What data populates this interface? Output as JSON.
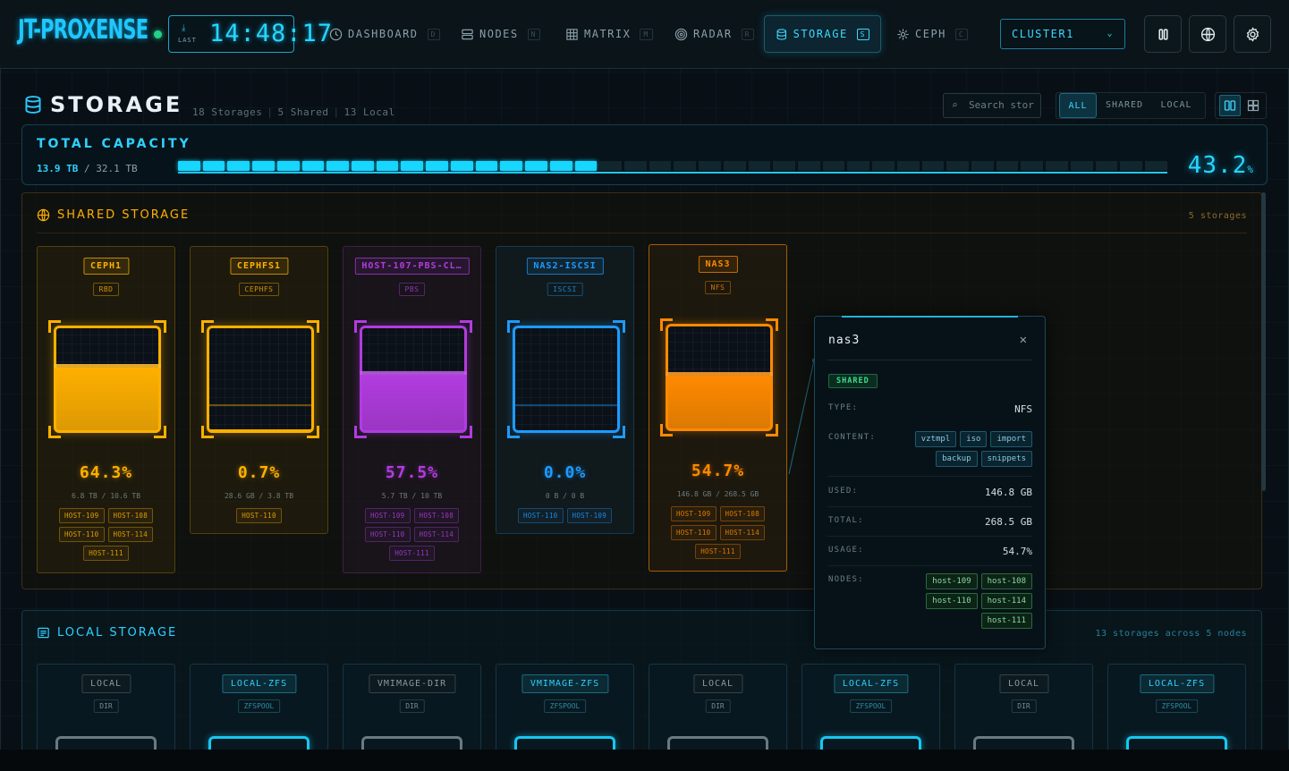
{
  "app": {
    "logo": "JT-PROXENSE",
    "clock_label": "LAST",
    "clock_time": "14:48:17"
  },
  "nav": [
    {
      "label": "DASHBOARD",
      "key": "D",
      "icon": "clock-icon"
    },
    {
      "label": "NODES",
      "key": "N",
      "icon": "server-icon"
    },
    {
      "label": "MATRIX",
      "key": "M",
      "icon": "grid-icon"
    },
    {
      "label": "RADAR",
      "key": "R",
      "icon": "radar-icon"
    },
    {
      "label": "STORAGE",
      "key": "S",
      "icon": "database-icon",
      "active": true
    },
    {
      "label": "CEPH",
      "key": "C",
      "icon": "ceph-icon"
    }
  ],
  "cluster": {
    "selected": "CLUSTER1"
  },
  "header": {
    "title": "STORAGE",
    "stats": [
      "18 Storages",
      "5 Shared",
      "13 Local"
    ],
    "search_placeholder": "Search stor",
    "filters": [
      "ALL",
      "SHARED",
      "LOCAL"
    ],
    "active_filter": "ALL"
  },
  "capacity": {
    "title": "TOTAL CAPACITY",
    "used": "13.9 TB",
    "total": "/ 32.1 TB",
    "percent": "43.2",
    "percent_unit": "%",
    "fill_fraction": 0.432
  },
  "shared": {
    "title": "SHARED STORAGE",
    "count": "5 storages",
    "cards": [
      {
        "name": "CEPH1",
        "type": "RBD",
        "pct": "64.3%",
        "fill": 0.643,
        "size": "6.8 TB / 10.6 TB",
        "hosts": [
          "HOST-109",
          "HOST-108",
          "HOST-110",
          "HOST-114",
          "HOST-111"
        ],
        "color": "#ffb000"
      },
      {
        "name": "CEPHFS1",
        "type": "CEPHFS",
        "pct": "0.7%",
        "fill": 0.007,
        "size": "28.6 GB / 3.8 TB",
        "hosts": [
          "HOST-110"
        ],
        "color": "#ffb000"
      },
      {
        "name": "HOST-107-PBS-CL…",
        "type": "PBS",
        "pct": "57.5%",
        "fill": 0.575,
        "size": "5.7 TB / 10 TB",
        "hosts": [
          "HOST-109",
          "HOST-108",
          "HOST-110",
          "HOST-114",
          "HOST-111"
        ],
        "color": "#b23ce0"
      },
      {
        "name": "NAS2-ISCSI",
        "type": "ISCSI",
        "pct": "0.0%",
        "fill": 0.0,
        "size": "0 B / 0 B",
        "hosts": [
          "HOST-110",
          "HOST-109"
        ],
        "color": "#1e9bff"
      },
      {
        "name": "NAS3",
        "type": "NFS",
        "pct": "54.7%",
        "fill": 0.547,
        "size": "146.8 GB / 268.5 GB",
        "hosts": [
          "HOST-109",
          "HOST-108",
          "HOST-110",
          "HOST-114",
          "HOST-111"
        ],
        "color": "#ff8a00"
      }
    ]
  },
  "tooltip": {
    "title": "nas3",
    "badge": "SHARED",
    "type_label": "TYPE:",
    "type_value": "NFS",
    "content_label": "CONTENT:",
    "content": [
      "vztmpl",
      "iso",
      "import",
      "backup",
      "snippets"
    ],
    "used_label": "USED:",
    "used_value": "146.8 GB",
    "total_label": "TOTAL:",
    "total_value": "268.5 GB",
    "usage_label": "USAGE:",
    "usage_value": "54.7%",
    "nodes_label": "NODES:",
    "nodes": [
      "host-109",
      "host-108",
      "host-110",
      "host-114",
      "host-111"
    ]
  },
  "local": {
    "title": "LOCAL STORAGE",
    "count": "13 storages across 5 nodes",
    "cards": [
      {
        "name": "LOCAL",
        "type": "DIR",
        "kind": "dir"
      },
      {
        "name": "LOCAL-ZFS",
        "type": "ZFSPOOL",
        "kind": "zfs"
      },
      {
        "name": "VMIMAGE-DIR",
        "type": "DIR",
        "kind": "dir"
      },
      {
        "name": "VMIMAGE-ZFS",
        "type": "ZFSPOOL",
        "kind": "zfs"
      },
      {
        "name": "LOCAL",
        "type": "DIR",
        "kind": "dir"
      },
      {
        "name": "LOCAL-ZFS",
        "type": "ZFSPOOL",
        "kind": "zfs"
      },
      {
        "name": "LOCAL",
        "type": "DIR",
        "kind": "dir"
      },
      {
        "name": "LOCAL-ZFS",
        "type": "ZFSPOOL",
        "kind": "zfs"
      }
    ]
  },
  "colors": {
    "accent": "#27d6ff",
    "shared_accent": "#ffb000",
    "ok": "#38e08c"
  }
}
